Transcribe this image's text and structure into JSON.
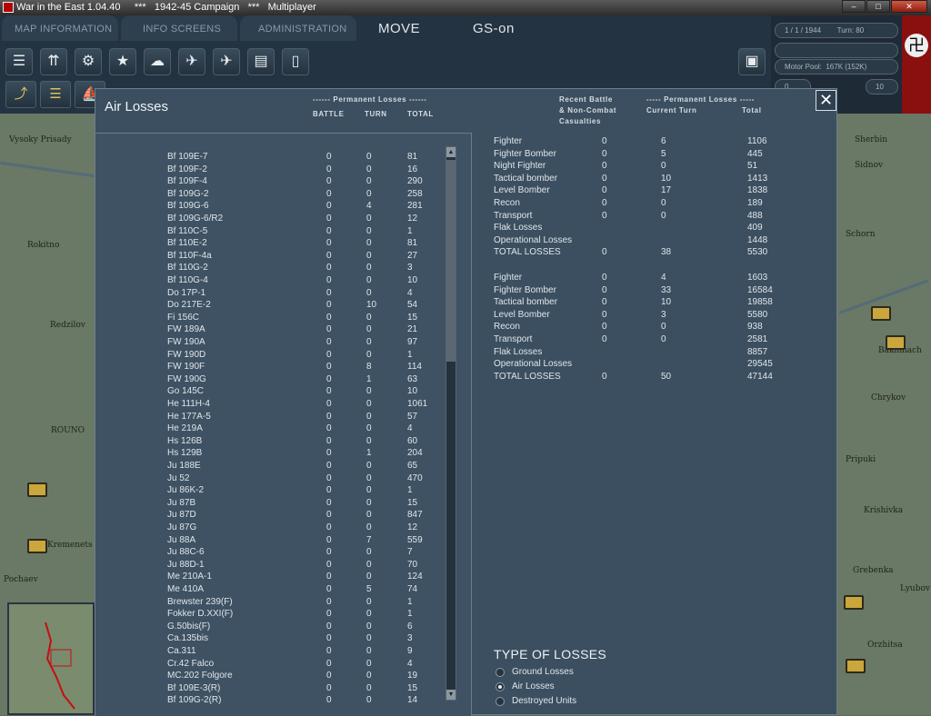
{
  "window": {
    "title": "War in the East 1.04.40     ***   1942-45 Campaign   ***   Multiplayer"
  },
  "menu": {
    "map_information": "MAP INFORMATION",
    "info_screens": "INFO SCREENS",
    "administration": "ADMINISTRATION",
    "move": "MOVE",
    "gs": "GS-on"
  },
  "info": {
    "date": "1 / 1 / 1944",
    "turn": "Turn: 80",
    "motor_pool": "Motor Pool:  167K (152K)",
    "zero": "0",
    "ten": "10"
  },
  "map_labels": [
    "Vysoky Prisady",
    "Sherbin",
    "Rokitno",
    "Redzilov",
    "ROUNO",
    "Kremenets",
    "Pochaev",
    "Bakhmach",
    "Chrykov",
    "Schorn",
    "Krishivka",
    "Pripuki",
    "Lyubov",
    "Orzhitsa",
    "Grebenka",
    "Sidnov"
  ],
  "panel": {
    "title": "Air Losses",
    "left_header": {
      "perm": "------ Permanent Losses ------",
      "battle": "BATTLE",
      "turn": "TURN",
      "total": "TOTAL"
    },
    "right_header": {
      "recent_line1": "Recent Battle",
      "recent_line2": "& Non-Combat",
      "recent_line3": "Casualties",
      "perm": "----- Permanent Losses -----",
      "current_turn": "Current Turn",
      "total": "Total"
    },
    "close": "✕",
    "aircraft": [
      [
        "Bf 109E-7",
        "0",
        "0",
        "81"
      ],
      [
        "Bf 109F-2",
        "0",
        "0",
        "16"
      ],
      [
        "Bf 109F-4",
        "0",
        "0",
        "290"
      ],
      [
        "Bf 109G-2",
        "0",
        "0",
        "258"
      ],
      [
        "Bf 109G-6",
        "0",
        "4",
        "281"
      ],
      [
        "Bf 109G-6/R2",
        "0",
        "0",
        "12"
      ],
      [
        "Bf 110C-5",
        "0",
        "0",
        "1"
      ],
      [
        "Bf 110E-2",
        "0",
        "0",
        "81"
      ],
      [
        "Bf 110F-4a",
        "0",
        "0",
        "27"
      ],
      [
        "Bf 110G-2",
        "0",
        "0",
        "3"
      ],
      [
        "Bf 110G-4",
        "0",
        "0",
        "10"
      ],
      [
        "Do 17P-1",
        "0",
        "0",
        "4"
      ],
      [
        "Do 217E-2",
        "0",
        "10",
        "54"
      ],
      [
        "Fi 156C",
        "0",
        "0",
        "15"
      ],
      [
        "FW 189A",
        "0",
        "0",
        "21"
      ],
      [
        "FW 190A",
        "0",
        "0",
        "97"
      ],
      [
        "FW 190D",
        "0",
        "0",
        "1"
      ],
      [
        "FW 190F",
        "0",
        "8",
        "114"
      ],
      [
        "FW 190G",
        "0",
        "1",
        "63"
      ],
      [
        "Go 145C",
        "0",
        "0",
        "10"
      ],
      [
        "He 111H-4",
        "0",
        "0",
        "1061"
      ],
      [
        "He 177A-5",
        "0",
        "0",
        "57"
      ],
      [
        "He 219A",
        "0",
        "0",
        "4"
      ],
      [
        "Hs 126B",
        "0",
        "0",
        "60"
      ],
      [
        "Hs 129B",
        "0",
        "1",
        "204"
      ],
      [
        "Ju 188E",
        "0",
        "0",
        "65"
      ],
      [
        "Ju 52",
        "0",
        "0",
        "470"
      ],
      [
        "Ju 86K-2",
        "0",
        "0",
        "1"
      ],
      [
        "Ju 87B",
        "0",
        "0",
        "15"
      ],
      [
        "Ju 87D",
        "0",
        "0",
        "847"
      ],
      [
        "Ju 87G",
        "0",
        "0",
        "12"
      ],
      [
        "Ju 88A",
        "0",
        "7",
        "559"
      ],
      [
        "Ju 88C-6",
        "0",
        "0",
        "7"
      ],
      [
        "Ju 88D-1",
        "0",
        "0",
        "70"
      ],
      [
        "Me 210A-1",
        "0",
        "0",
        "124"
      ],
      [
        "Me 410A",
        "0",
        "5",
        "74"
      ],
      [
        "Brewster 239(F)",
        "0",
        "0",
        "1"
      ],
      [
        "Fokker D.XXI(F)",
        "0",
        "0",
        "1"
      ],
      [
        "G.50bis(F)",
        "0",
        "0",
        "6"
      ],
      [
        "Ca.135bis",
        "0",
        "0",
        "3"
      ],
      [
        "Ca.311",
        "0",
        "0",
        "9"
      ],
      [
        "Cr.42 Falco",
        "0",
        "0",
        "4"
      ],
      [
        "MC.202 Folgore",
        "0",
        "0",
        "19"
      ],
      [
        "Bf 109E-3(R)",
        "0",
        "0",
        "15"
      ],
      [
        "Bf 109G-2(R)",
        "0",
        "0",
        "14"
      ]
    ],
    "axis_summary": [
      [
        "Fighter",
        "0",
        "6",
        "1106"
      ],
      [
        "Fighter Bomber",
        "0",
        "5",
        "445"
      ],
      [
        "Night Fighter",
        "0",
        "0",
        "51"
      ],
      [
        "Tactical bomber",
        "0",
        "10",
        "1413"
      ],
      [
        "Level Bomber",
        "0",
        "17",
        "1838"
      ],
      [
        "Recon",
        "0",
        "0",
        "189"
      ],
      [
        "Transport",
        "0",
        "0",
        "488"
      ],
      [
        "Flak Losses",
        "",
        "",
        "409"
      ],
      [
        "Operational Losses",
        "",
        "",
        "1448"
      ],
      [
        "TOTAL LOSSES",
        "0",
        "38",
        "5530"
      ]
    ],
    "soviet_summary": [
      [
        "Fighter",
        "0",
        "4",
        "1603"
      ],
      [
        "Fighter Bomber",
        "0",
        "33",
        "16584"
      ],
      [
        "Tactical bomber",
        "0",
        "10",
        "19858"
      ],
      [
        "Level Bomber",
        "0",
        "3",
        "5580"
      ],
      [
        "Recon",
        "0",
        "0",
        "938"
      ],
      [
        "Transport",
        "0",
        "0",
        "2581"
      ],
      [
        "Flak Losses",
        "",
        "",
        "8857"
      ],
      [
        "Operational Losses",
        "",
        "",
        "29545"
      ],
      [
        "TOTAL LOSSES",
        "0",
        "50",
        "47144"
      ]
    ],
    "type_of_losses": {
      "title": "TYPE OF LOSSES",
      "options": [
        "Ground Losses",
        "Air Losses",
        "Destroyed Units"
      ],
      "selected": "Air Losses"
    }
  },
  "colors": {
    "panel": "#3b4f60",
    "toolbar": "#243341",
    "flag": "#8a0f0f",
    "unit": "#caa63c"
  }
}
